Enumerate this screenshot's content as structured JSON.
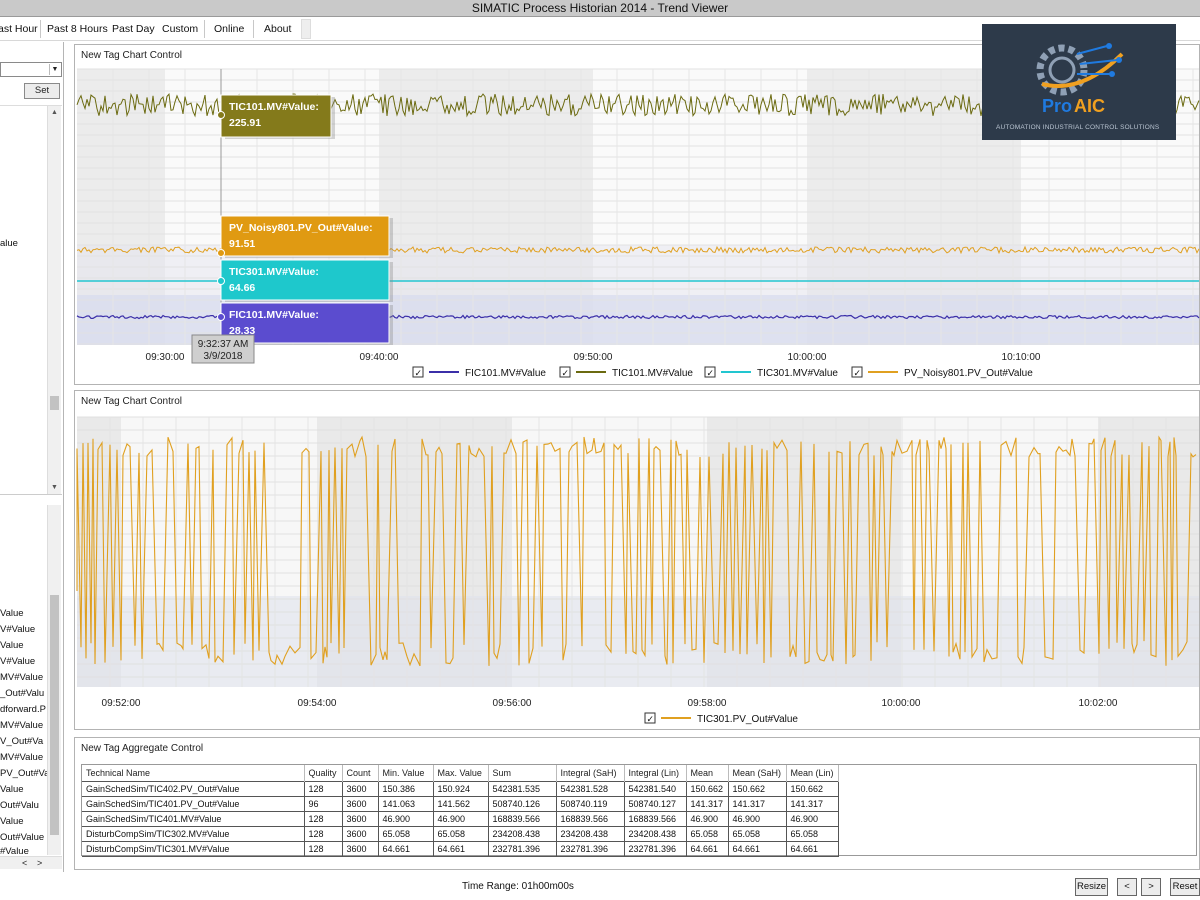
{
  "window": {
    "title": "SIMATIC Process Historian 2014 - Trend Viewer"
  },
  "menu": {
    "items": [
      "ast Hour",
      "Past 8 Hours",
      "Past Day",
      "Custom",
      "Online",
      "About"
    ]
  },
  "left_panel": {
    "set_label": "Set",
    "tree_top": [
      "alue"
    ],
    "tree_bottom": [
      "Value",
      "V#Value",
      "Value",
      "V#Value",
      "MV#Value",
      "_Out#Valu",
      "dforward.P",
      "MV#Value",
      "V_Out#Va",
      "MV#Value",
      "PV_Out#Va",
      "Value",
      "Out#Valu",
      "Value",
      "Out#Value",
      "#Value"
    ],
    "scroll_left": "<",
    "scroll_right": ">"
  },
  "chart1": {
    "title": "New Tag Chart Control",
    "cursor_time": "9:32:37 AM",
    "cursor_date": "3/9/2018",
    "tooltips": [
      {
        "name": "TIC101.MV#Value:",
        "value": "225.91",
        "color": "#847a1b"
      },
      {
        "name": "PV_Noisy801.PV_Out#Value:",
        "value": "91.51",
        "color": "#e09a12"
      },
      {
        "name": "TIC301.MV#Value:",
        "value": "64.66",
        "color": "#1ec8cc"
      },
      {
        "name": "FIC101.MV#Value:",
        "value": "28.33",
        "color": "#5b4ccf"
      }
    ],
    "x_ticks": [
      "09:30:00",
      "09:40:00",
      "09:50:00",
      "10:00:00",
      "10:10:00"
    ],
    "legend": [
      {
        "name": "FIC101.MV#Value",
        "color": "#3b2fa8"
      },
      {
        "name": "TIC101.MV#Value",
        "color": "#6b6a10"
      },
      {
        "name": "TIC301.MV#Value",
        "color": "#22c6d0"
      },
      {
        "name": "PV_Noisy801.PV_Out#Value",
        "color": "#e0a020"
      }
    ]
  },
  "chart2": {
    "title": "New Tag Chart Control",
    "x_ticks": [
      "09:52:00",
      "09:54:00",
      "09:56:00",
      "09:58:00",
      "10:00:00",
      "10:02:00"
    ],
    "legend": [
      {
        "name": "TIC301.PV_Out#Value",
        "color": "#e0a020"
      }
    ]
  },
  "aggregate": {
    "title": "New Tag Aggregate Control",
    "columns": [
      "Technical Name",
      "Quality",
      "Count",
      "Min. Value",
      "Max. Value",
      "Sum",
      "Integral (SaH)",
      "Integral (Lin)",
      "Mean",
      "Mean (SaH)",
      "Mean (Lin)"
    ],
    "rows": [
      [
        "GainSchedSim/TIC402.PV_Out#Value",
        "128",
        "3600",
        "150.386",
        "150.924",
        "542381.535",
        "542381.528",
        "542381.540",
        "150.662",
        "150.662",
        "150.662"
      ],
      [
        "GainSchedSim/TIC401.PV_Out#Value",
        "96",
        "3600",
        "141.063",
        "141.562",
        "508740.126",
        "508740.119",
        "508740.127",
        "141.317",
        "141.317",
        "141.317"
      ],
      [
        "GainSchedSim/TIC401.MV#Value",
        "128",
        "3600",
        "46.900",
        "46.900",
        "168839.566",
        "168839.566",
        "168839.566",
        "46.900",
        "46.900",
        "46.900"
      ],
      [
        "DisturbCompSim/TIC302.MV#Value",
        "128",
        "3600",
        "65.058",
        "65.058",
        "234208.438",
        "234208.438",
        "234208.438",
        "65.058",
        "65.058",
        "65.058"
      ],
      [
        "DisturbCompSim/TIC301.MV#Value",
        "128",
        "3600",
        "64.661",
        "64.661",
        "232781.396",
        "232781.396",
        "232781.396",
        "64.661",
        "64.661",
        "64.661"
      ]
    ]
  },
  "footer": {
    "time_range": "Time Range: 01h00m00s",
    "resize": "Resize",
    "prev": "<",
    "next": ">",
    "reset": "Reset"
  },
  "logo": {
    "brand_a": "Pro",
    "brand_b": "AIC",
    "tagline": "AUTOMATION INDUSTRIAL CONTROL SOLUTIONS"
  }
}
